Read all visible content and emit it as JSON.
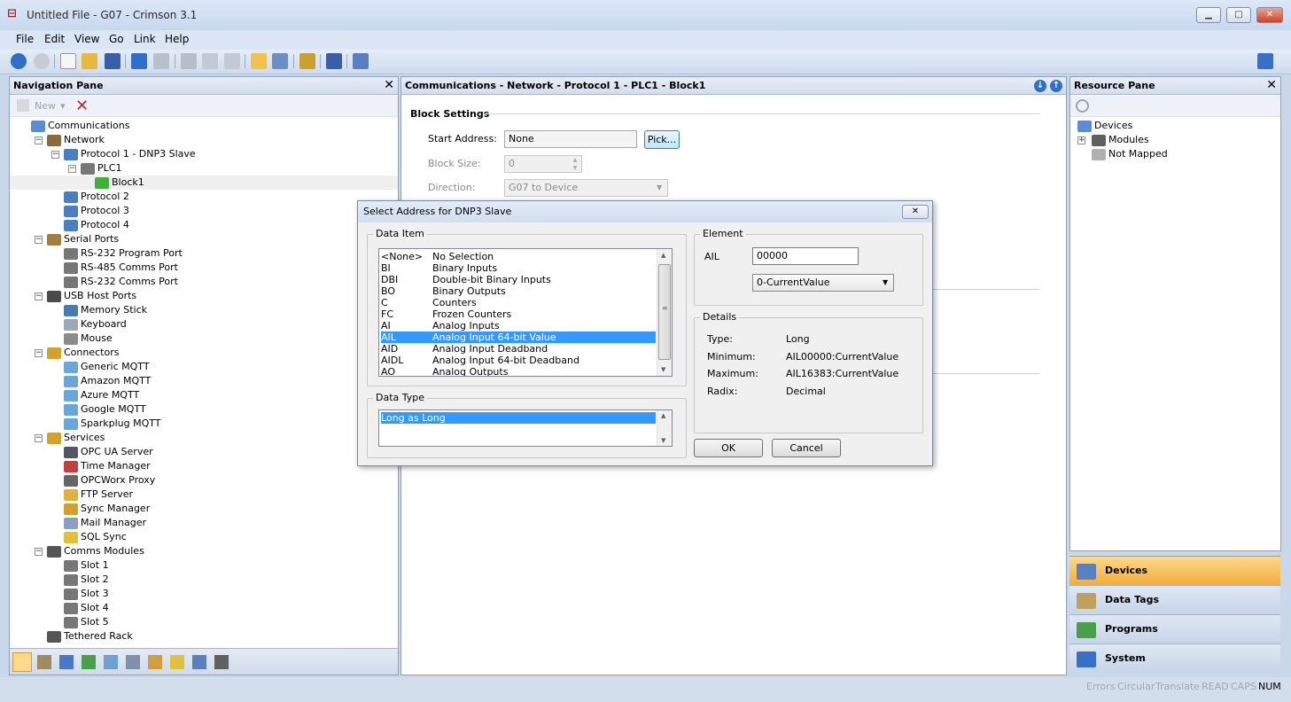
{
  "window": {
    "title": "Untitled File - G07 - Crimson 3.1",
    "min": "▁",
    "max": "□",
    "close": "✕"
  },
  "menu": [
    "File",
    "Edit",
    "View",
    "Go",
    "Link",
    "Help"
  ],
  "nav": {
    "header": "Navigation Pane",
    "new_label": "New",
    "tree": [
      {
        "label": "Communications",
        "depth": 0,
        "exp": "",
        "icon": "communications-icon",
        "color": "#5b8bd0"
      },
      {
        "label": "Network",
        "depth": 1,
        "exp": "−",
        "icon": "network-icon",
        "color": "#8a6a40"
      },
      {
        "label": "Protocol 1 - DNP3 Slave",
        "depth": 2,
        "exp": "−",
        "icon": "protocol-icon",
        "color": "#4d7fbf"
      },
      {
        "label": "PLC1",
        "depth": 3,
        "exp": "−",
        "icon": "plc-icon",
        "color": "#777"
      },
      {
        "label": "Block1",
        "depth": 4,
        "exp": "",
        "icon": "block-icon",
        "color": "#3fae3a"
      },
      {
        "label": "Protocol 2",
        "depth": 2,
        "exp": "",
        "icon": "protocol-icon",
        "color": "#4d7fbf"
      },
      {
        "label": "Protocol 3",
        "depth": 2,
        "exp": "",
        "icon": "protocol-icon",
        "color": "#4d7fbf"
      },
      {
        "label": "Protocol 4",
        "depth": 2,
        "exp": "",
        "icon": "protocol-icon",
        "color": "#4d7fbf"
      },
      {
        "label": "Serial Ports",
        "depth": 1,
        "exp": "−",
        "icon": "serial-ports-icon",
        "color": "#a08040"
      },
      {
        "label": "RS-232 Program Port",
        "depth": 2,
        "exp": "",
        "icon": "serial-port-icon",
        "color": "#777"
      },
      {
        "label": "RS-485 Comms Port",
        "depth": 2,
        "exp": "",
        "icon": "serial-port-icon",
        "color": "#777"
      },
      {
        "label": "RS-232 Comms Port",
        "depth": 2,
        "exp": "",
        "icon": "serial-port-icon",
        "color": "#777"
      },
      {
        "label": "USB Host Ports",
        "depth": 1,
        "exp": "−",
        "icon": "usb-icon",
        "color": "#4a4a4a"
      },
      {
        "label": "Memory Stick",
        "depth": 2,
        "exp": "",
        "icon": "memory-stick-icon",
        "color": "#4a78b0"
      },
      {
        "label": "Keyboard",
        "depth": 2,
        "exp": "",
        "icon": "keyboard-icon",
        "color": "#9aa8b8"
      },
      {
        "label": "Mouse",
        "depth": 2,
        "exp": "",
        "icon": "mouse-icon",
        "color": "#8c8c8c"
      },
      {
        "label": "Connectors",
        "depth": 1,
        "exp": "−",
        "icon": "connectors-icon",
        "color": "#d4a030"
      },
      {
        "label": "Generic MQTT",
        "depth": 2,
        "exp": "",
        "icon": "cloud-icon",
        "color": "#6aa6d8"
      },
      {
        "label": "Amazon MQTT",
        "depth": 2,
        "exp": "",
        "icon": "cloud-icon",
        "color": "#6aa6d8"
      },
      {
        "label": "Azure MQTT",
        "depth": 2,
        "exp": "",
        "icon": "cloud-icon",
        "color": "#6aa6d8"
      },
      {
        "label": "Google MQTT",
        "depth": 2,
        "exp": "",
        "icon": "cloud-icon",
        "color": "#6aa6d8"
      },
      {
        "label": "Sparkplug MQTT",
        "depth": 2,
        "exp": "",
        "icon": "cloud-icon",
        "color": "#6aa6d8"
      },
      {
        "label": "Services",
        "depth": 1,
        "exp": "−",
        "icon": "services-icon",
        "color": "#d4a030"
      },
      {
        "label": "OPC UA Server",
        "depth": 2,
        "exp": "",
        "icon": "opc-ua-icon",
        "color": "#556"
      },
      {
        "label": "Time Manager",
        "depth": 2,
        "exp": "",
        "icon": "clock-icon",
        "color": "#c04040"
      },
      {
        "label": "OPCWorx Proxy",
        "depth": 2,
        "exp": "",
        "icon": "proxy-icon",
        "color": "#666"
      },
      {
        "label": "FTP Server",
        "depth": 2,
        "exp": "",
        "icon": "ftp-icon",
        "color": "#e0b040"
      },
      {
        "label": "Sync Manager",
        "depth": 2,
        "exp": "",
        "icon": "sync-icon",
        "color": "#d0a030"
      },
      {
        "label": "Mail Manager",
        "depth": 2,
        "exp": "",
        "icon": "mail-icon",
        "color": "#8aa0c0"
      },
      {
        "label": "SQL Sync",
        "depth": 2,
        "exp": "",
        "icon": "sql-icon",
        "color": "#e0c040"
      },
      {
        "label": "Comms Modules",
        "depth": 1,
        "exp": "−",
        "icon": "comms-modules-icon",
        "color": "#555"
      },
      {
        "label": "Slot 1",
        "depth": 2,
        "exp": "",
        "icon": "slot-icon",
        "color": "#777"
      },
      {
        "label": "Slot 2",
        "depth": 2,
        "exp": "",
        "icon": "slot-icon",
        "color": "#777"
      },
      {
        "label": "Slot 3",
        "depth": 2,
        "exp": "",
        "icon": "slot-icon",
        "color": "#777"
      },
      {
        "label": "Slot 4",
        "depth": 2,
        "exp": "",
        "icon": "slot-icon",
        "color": "#777"
      },
      {
        "label": "Slot 5",
        "depth": 2,
        "exp": "",
        "icon": "slot-icon",
        "color": "#777"
      },
      {
        "label": "Tethered Rack",
        "depth": 1,
        "exp": "",
        "icon": "rack-icon",
        "color": "#555"
      }
    ]
  },
  "editor": {
    "breadcrumb": "Communications - Network - Protocol 1 - PLC1 - Block1",
    "section": "Block Settings",
    "start_address_label": "Start Address:",
    "start_address_value": "None",
    "pick_label": "Pick...",
    "block_size_label": "Block Size:",
    "block_size_value": "0",
    "direction_label": "Direction:",
    "direction_value": "G07 to Device"
  },
  "dialog": {
    "title": "Select Address for DNP3 Slave",
    "close": "✕",
    "data_item_label": "Data Item",
    "data_items": [
      {
        "code": "<None>",
        "desc": "No Selection"
      },
      {
        "code": "BI",
        "desc": "Binary Inputs"
      },
      {
        "code": "DBI",
        "desc": "Double-bit Binary Inputs"
      },
      {
        "code": "BO",
        "desc": "Binary Outputs"
      },
      {
        "code": "C",
        "desc": "Counters"
      },
      {
        "code": "FC",
        "desc": "Frozen Counters"
      },
      {
        "code": "AI",
        "desc": "Analog Inputs"
      },
      {
        "code": "AIL",
        "desc": "Analog Input 64-bit Value",
        "selected": true
      },
      {
        "code": "AID",
        "desc": "Analog Input Deadband"
      },
      {
        "code": "AIDL",
        "desc": "Analog Input 64-bit Deadband"
      },
      {
        "code": "AO",
        "desc": "Analog Outputs"
      }
    ],
    "data_type_label": "Data Type",
    "data_types": [
      "Long as Long"
    ],
    "element_label": "Element",
    "element_prefix": "AIL",
    "element_value": "00000",
    "element_select": "0-CurrentValue",
    "details_label": "Details",
    "details": [
      {
        "k": "Type:",
        "v": "Long"
      },
      {
        "k": "Minimum:",
        "v": "AIL00000:CurrentValue"
      },
      {
        "k": "Maximum:",
        "v": "AIL16383:CurrentValue"
      },
      {
        "k": "Radix:",
        "v": "Decimal"
      }
    ],
    "ok": "OK",
    "cancel": "Cancel"
  },
  "resource": {
    "header": "Resource Pane",
    "tree": [
      {
        "label": "Devices",
        "x": 8
      },
      {
        "label": "Modules",
        "x": 24,
        "exp": "+"
      },
      {
        "label": "Not Mapped",
        "x": 24
      }
    ],
    "categories": [
      {
        "label": "Devices",
        "active": true
      },
      {
        "label": "Data Tags"
      },
      {
        "label": "Programs"
      },
      {
        "label": "System"
      }
    ]
  },
  "status": [
    "Errors",
    "Circular",
    "Translate",
    "READ",
    "CAPS",
    "NUM"
  ],
  "colors": {
    "accent": "#3399ff",
    "active_tab": "#f3ad3b"
  }
}
